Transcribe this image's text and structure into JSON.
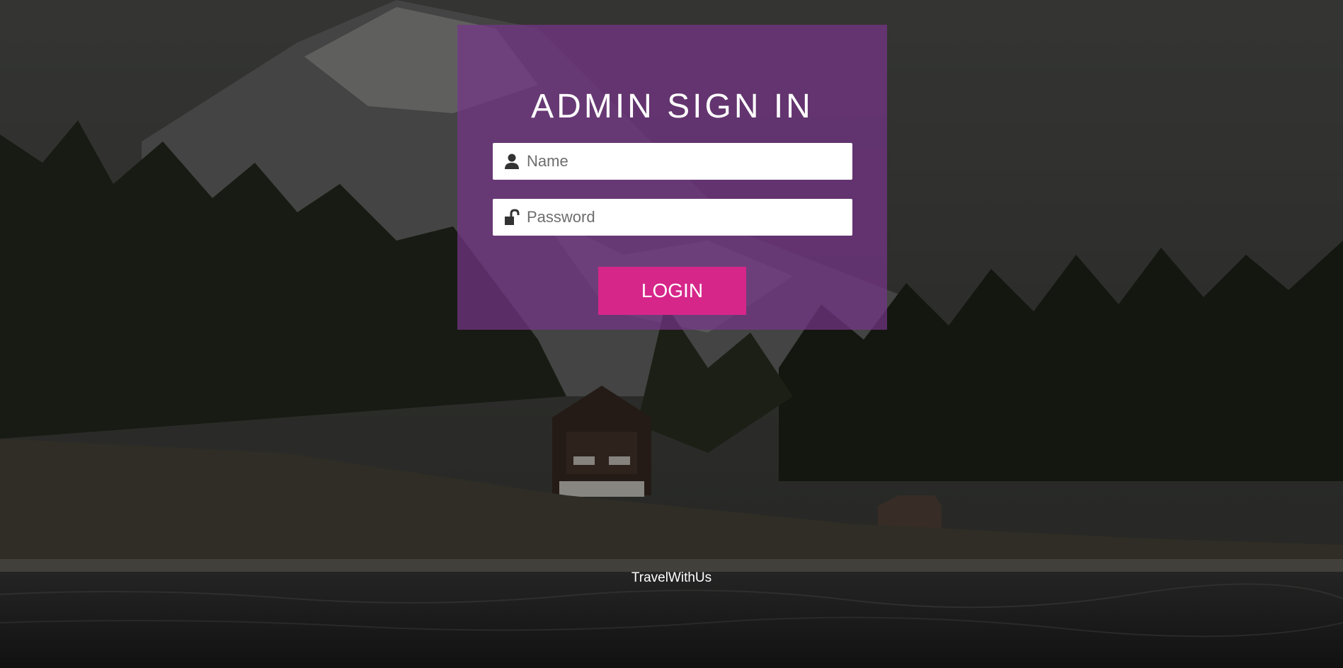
{
  "login_form": {
    "title": "ADMIN SIGN IN",
    "name_placeholder": "Name",
    "password_placeholder": "Password",
    "login_label": "LOGIN"
  },
  "footer": {
    "brand": "TravelWithUs"
  },
  "colors": {
    "panel": "#763488",
    "button": "#d6268a",
    "text": "#ffffff"
  },
  "icons": [
    "user-icon",
    "unlock-icon"
  ],
  "background": "mountain-lake-forest-photo"
}
